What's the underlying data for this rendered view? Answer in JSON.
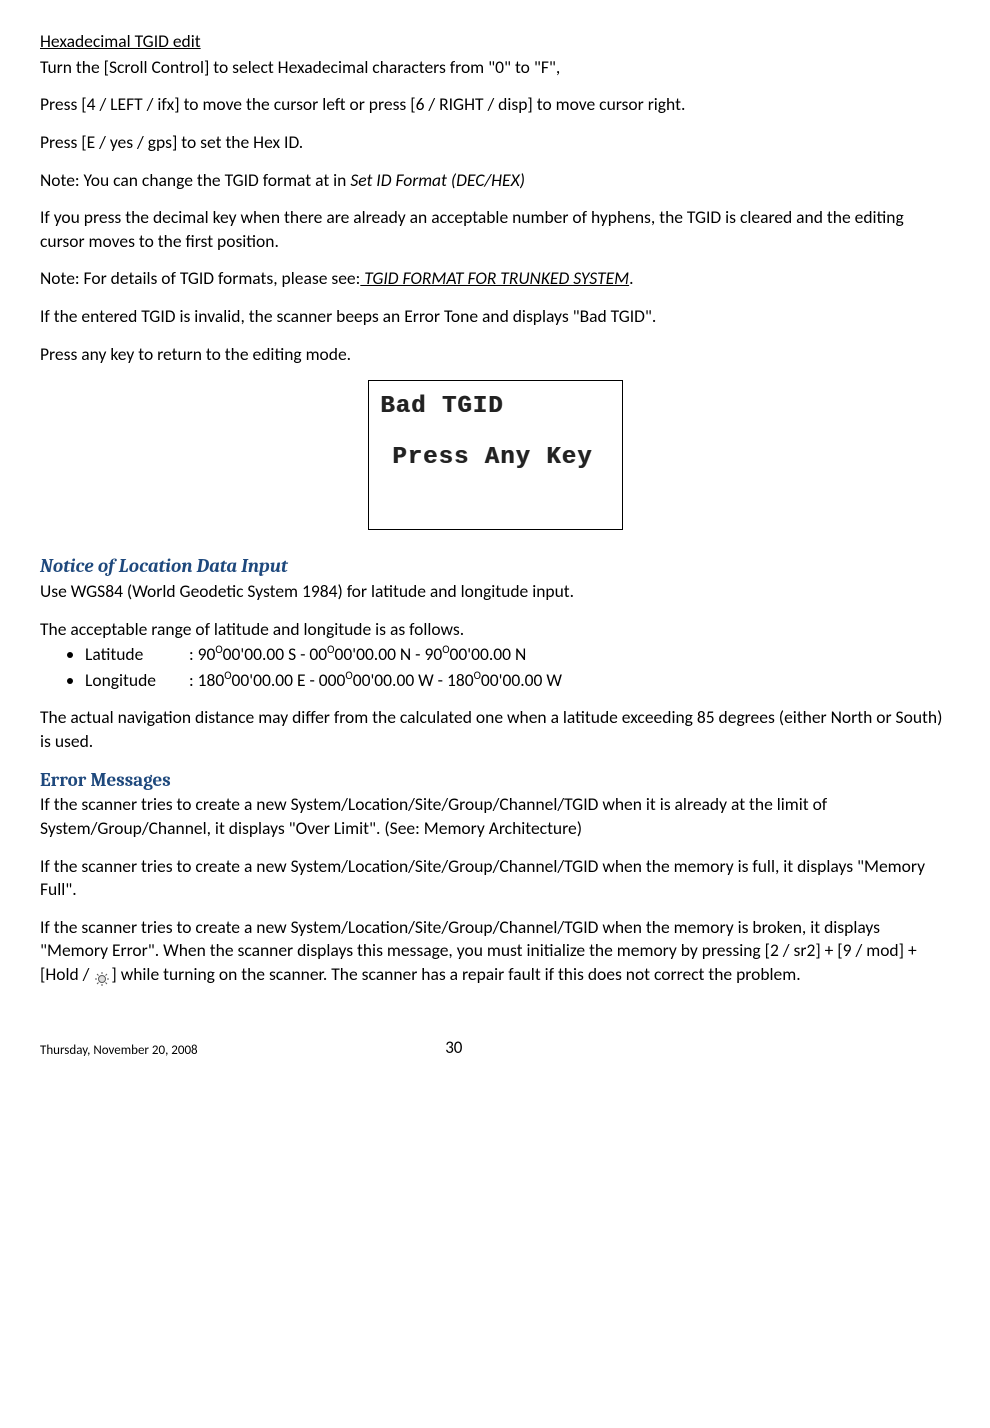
{
  "section1": {
    "title": "Hexadecimal TGID edit",
    "p1": "Turn the [Scroll Control] to select Hexadecimal characters from \"0\" to \"F\",",
    "p2": "Press [4 / LEFT / ifx] to move the cursor left or press [6 / RIGHT / disp] to move cursor right.",
    "p3": "Press [E / yes / gps] to set the Hex ID.",
    "p4_a": "Note: You can change the TGID format at in ",
    "p4_b": "Set ID Format (DEC/HEX)",
    "p5": "If you press the decimal key when there are already an acceptable number of hyphens, the TGID is cleared and the editing cursor moves to the first position.",
    "p6_a": "Note: For details of TGID formats, please see:",
    "p6_b": " TGID FORMAT FOR TRUNKED SYSTEM",
    "p6_c": ".",
    "p7": "If the entered TGID is invalid, the scanner beeps an Error Tone and displays \"Bad TGID\".",
    "p8": "Press any key to return to the editing mode."
  },
  "lcd": {
    "line1": "Bad TGID",
    "line2": "Press Any Key"
  },
  "notice": {
    "heading": "Notice of Location Data Input",
    "p1": "Use WGS84 (World Geodetic System 1984) for latitude and longitude input.",
    "p2": "The acceptable range of latitude and longitude is as follows.",
    "lat_label": "Latitude",
    "lat_val": ": 90º00'00.00 S - 00º00'00.00 N - 90º00'00.00 N",
    "lon_label": "Longitude",
    "lon_val": ": 180º00'00.00 E - 000º00'00.00 W - 180º00'00.00 W",
    "p3": "The actual navigation distance may differ from the calculated one when a latitude exceeding 85 degrees (either North or South) is used."
  },
  "errors": {
    "heading": "Error Messages",
    "p1": "If the scanner tries to create a new System/Location/Site/Group/Channel/TGID when it is already at the limit of System/Group/Channel, it displays \"Over Limit\".  (See: Memory Architecture)",
    "p2": "If the scanner tries to create a new System/Location/Site/Group/Channel/TGID when the memory is full, it displays \"Memory Full\".",
    "p3_a": "If the scanner tries to create a new System/Location/Site/Group/Channel/TGID when the memory is broken, it displays \"Memory Error\". When the scanner displays this message, you must initialize the memory by pressing [2 / sr2] + [9 / mod] + [Hold / ",
    "p3_b": "] while turning on the scanner. The scanner has a repair fault if this does not correct the problem."
  },
  "footer": {
    "date": "Thursday, November 20, 2008",
    "page": "30"
  }
}
